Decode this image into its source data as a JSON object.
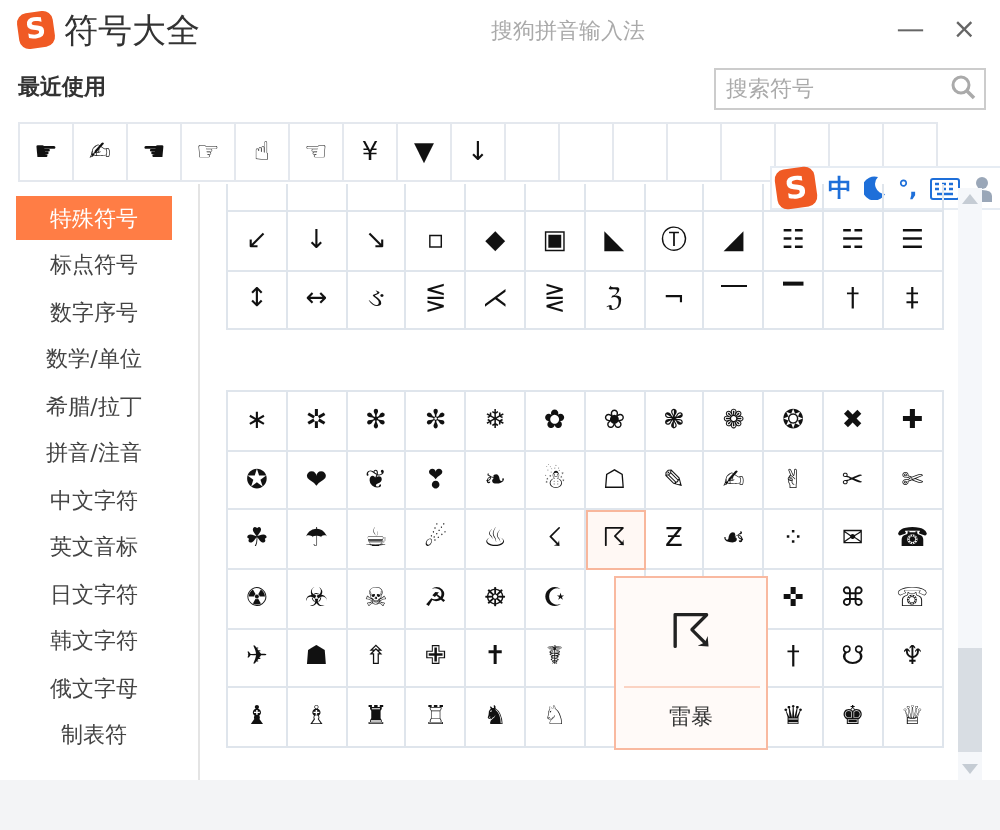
{
  "window": {
    "logo": "S",
    "title": "符号大全",
    "app_name": "搜狗拼音输入法",
    "minimize": "—",
    "close": "×"
  },
  "recent": {
    "label": "最近使用",
    "symbols": [
      "☛",
      "✍",
      "☚",
      "☞",
      "☝",
      "☜",
      "¥",
      "▼",
      "↓"
    ]
  },
  "search": {
    "placeholder": "搜索符号"
  },
  "ime_bar": {
    "logo": "S",
    "mode": "中",
    "punct": "°,"
  },
  "sidebar": {
    "items": [
      {
        "label": "特殊符号",
        "selected": true
      },
      {
        "label": "标点符号",
        "selected": false
      },
      {
        "label": "数字序号",
        "selected": false
      },
      {
        "label": "数学/单位",
        "selected": false
      },
      {
        "label": "希腊/拉丁",
        "selected": false
      },
      {
        "label": "拼音/注音",
        "selected": false
      },
      {
        "label": "中文字符",
        "selected": false
      },
      {
        "label": "英文音标",
        "selected": false
      },
      {
        "label": "日文字符",
        "selected": false
      },
      {
        "label": "韩文字符",
        "selected": false
      },
      {
        "label": "俄文字母",
        "selected": false
      },
      {
        "label": "制表符",
        "selected": false
      }
    ]
  },
  "sections": [
    {
      "rows": [
        [
          {
            "symbol": "↙",
            "selected": false
          },
          {
            "symbol": "↓",
            "selected": false
          },
          {
            "symbol": "↘",
            "selected": false
          },
          {
            "symbol": "▫",
            "selected": false
          },
          {
            "symbol": "◆",
            "selected": false
          },
          {
            "symbol": "▣",
            "selected": false
          },
          {
            "symbol": "◣",
            "selected": false
          },
          {
            "symbol": "Ⓣ",
            "selected": false
          },
          {
            "symbol": "◢",
            "selected": false
          },
          {
            "symbol": "☷",
            "selected": false
          },
          {
            "symbol": "☵",
            "selected": false
          },
          {
            "symbol": "☰",
            "selected": false
          }
        ],
        [
          {
            "symbol": "↕",
            "selected": false
          },
          {
            "symbol": "↔",
            "selected": false
          },
          {
            "symbol": "ઙ",
            "selected": false
          },
          {
            "symbol": "⋚",
            "selected": false
          },
          {
            "symbol": "⋌",
            "selected": false
          },
          {
            "symbol": "⋛",
            "selected": false
          },
          {
            "symbol": "ℨ",
            "selected": false
          },
          {
            "symbol": "¬",
            "selected": false
          },
          {
            "symbol": "⎺",
            "selected": false
          },
          {
            "symbol": "▔",
            "selected": false
          },
          {
            "symbol": "†",
            "selected": false
          },
          {
            "symbol": "‡",
            "selected": false
          }
        ]
      ]
    },
    {
      "rows": [
        [
          {
            "symbol": "∗",
            "selected": false
          },
          {
            "symbol": "✲",
            "selected": false
          },
          {
            "symbol": "✻",
            "selected": false
          },
          {
            "symbol": "✼",
            "selected": false
          },
          {
            "symbol": "❄",
            "selected": false
          },
          {
            "symbol": "✿",
            "selected": false
          },
          {
            "symbol": "❀",
            "selected": false
          },
          {
            "symbol": "❃",
            "selected": false
          },
          {
            "symbol": "❁",
            "selected": false
          },
          {
            "symbol": "❂",
            "selected": false
          },
          {
            "symbol": "✖",
            "selected": false
          },
          {
            "symbol": "✚",
            "selected": false
          }
        ],
        [
          {
            "symbol": "✪",
            "selected": false
          },
          {
            "symbol": "❤",
            "selected": false
          },
          {
            "symbol": "❦",
            "selected": false
          },
          {
            "symbol": "❣",
            "selected": false
          },
          {
            "symbol": "❧",
            "selected": false
          },
          {
            "symbol": "☃",
            "selected": false
          },
          {
            "symbol": "☖",
            "selected": false
          },
          {
            "symbol": "✎",
            "selected": false
          },
          {
            "symbol": "✍",
            "selected": false
          },
          {
            "symbol": "✌",
            "selected": false
          },
          {
            "symbol": "✂",
            "selected": false
          },
          {
            "symbol": "✄",
            "selected": false
          }
        ],
        [
          {
            "symbol": "☘",
            "selected": false
          },
          {
            "symbol": "☂",
            "selected": false
          },
          {
            "symbol": "☕",
            "selected": false
          },
          {
            "symbol": "☄",
            "selected": false
          },
          {
            "symbol": "♨",
            "selected": false
          },
          {
            "symbol": "☇",
            "selected": false
          },
          {
            "symbol": "☈",
            "selected": true
          },
          {
            "symbol": "Ƶ",
            "selected": false
          },
          {
            "symbol": "☙",
            "selected": false
          },
          {
            "symbol": "⁘",
            "selected": false
          },
          {
            "symbol": "✉",
            "selected": false
          },
          {
            "symbol": "☎",
            "selected": false
          }
        ],
        [
          {
            "symbol": "☢",
            "selected": false
          },
          {
            "symbol": "☣",
            "selected": false
          },
          {
            "symbol": "☠",
            "selected": false
          },
          {
            "symbol": "☭",
            "selected": false
          },
          {
            "symbol": "☸",
            "selected": false
          },
          {
            "symbol": "☪",
            "selected": false
          },
          null,
          null,
          null,
          {
            "symbol": "✜",
            "selected": false
          },
          {
            "symbol": "⌘",
            "selected": false
          },
          {
            "symbol": "☏",
            "selected": false
          }
        ],
        [
          {
            "symbol": "✈",
            "selected": false
          },
          {
            "symbol": "☗",
            "selected": false
          },
          {
            "symbol": "⇮",
            "selected": false
          },
          {
            "symbol": "✙",
            "selected": false
          },
          {
            "symbol": "✝",
            "selected": false
          },
          {
            "symbol": "☤",
            "selected": false
          },
          null,
          null,
          null,
          {
            "symbol": "†",
            "selected": false
          },
          {
            "symbol": "☋",
            "selected": false
          },
          {
            "symbol": "♆",
            "selected": false
          }
        ],
        [
          {
            "symbol": "♝",
            "selected": false
          },
          {
            "symbol": "♗",
            "selected": false
          },
          {
            "symbol": "♜",
            "selected": false
          },
          {
            "symbol": "♖",
            "selected": false
          },
          {
            "symbol": "♞",
            "selected": false
          },
          {
            "symbol": "♘",
            "selected": false
          },
          null,
          null,
          null,
          {
            "symbol": "♛",
            "selected": false
          },
          {
            "symbol": "♚",
            "selected": false
          },
          {
            "symbol": "♕",
            "selected": false
          }
        ]
      ]
    }
  ],
  "tooltip": {
    "symbol": "☈",
    "name": "雷暴"
  }
}
